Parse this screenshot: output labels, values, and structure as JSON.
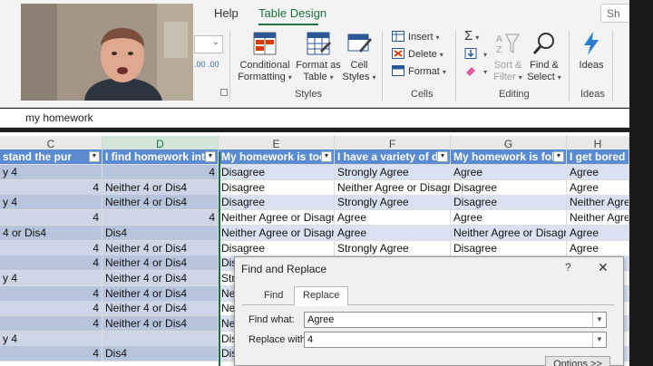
{
  "ribbon": {
    "tabs": {
      "help": "Help",
      "table_design": "Table Design"
    },
    "share": "Sh",
    "font_stub_arrow": "⌄",
    "number_stub": ".00  .00",
    "styles": {
      "conditional_formatting": [
        "Conditional",
        "Formatting"
      ],
      "format_as_table": [
        "Format as",
        "Table"
      ],
      "cell_styles": [
        "Cell",
        "Styles"
      ],
      "group_label": "Styles"
    },
    "cells": {
      "insert": "Insert",
      "delete": "Delete",
      "format": "Format",
      "group_label": "Cells"
    },
    "editing": {
      "sort_filter": [
        "Sort &",
        "Filter"
      ],
      "find_select": [
        "Find &",
        "Select"
      ],
      "group_label": "Editing"
    },
    "ideas": {
      "label": "Ideas",
      "group_label": "Ideas"
    },
    "colors": {
      "green": "#1e7145",
      "blue": "#2b5797",
      "red": "#d83b01"
    }
  },
  "formula_bar": {
    "text": "my homework"
  },
  "grid": {
    "column_headers": [
      "C",
      "D",
      "E",
      "F",
      "G",
      "H"
    ],
    "header_row": [
      "stand the pur",
      "I find homework inte",
      "My homework is too",
      "I have a variety of dif",
      "My homework is follo",
      "I get bored w"
    ],
    "rows": [
      [
        "y 4",
        "4",
        "Disagree",
        "Strongly Agree",
        "Agree",
        "Agree"
      ],
      [
        "4",
        "Neither 4 or Dis4",
        "Disagree",
        "Neither Agree or Disagree",
        "Disagree",
        "Agree"
      ],
      [
        "y 4",
        "Neither 4 or Dis4",
        "Disagree",
        "Strongly Agree",
        "Disagree",
        "Neither Agree"
      ],
      [
        "4",
        "4",
        "Neither Agree or Disagree",
        "Agree",
        "Agree",
        "Neither Agree"
      ],
      [
        "4 or Dis4",
        "Dis4",
        "Neither Agree or Disagree",
        "Agree",
        "Neither Agree or Disagree",
        "Agree"
      ],
      [
        "4",
        "Neither 4 or Dis4",
        "Disagree",
        "Strongly Agree",
        "Disagree",
        "Agree"
      ],
      [
        "4",
        "Neither 4 or Dis4",
        "Disagree",
        "",
        "",
        ""
      ],
      [
        "y 4",
        "Neither 4 or Dis4",
        "Str",
        "",
        "",
        ""
      ],
      [
        "4",
        "Neither 4 or Dis4",
        "Ne",
        "",
        "",
        ""
      ],
      [
        "4",
        "Neither 4 or Dis4",
        "Ne",
        "",
        "",
        ""
      ],
      [
        "4",
        "Neither 4 or Dis4",
        "Ne",
        "",
        "",
        ""
      ],
      [
        "y 4",
        "",
        "Dis",
        "",
        "",
        ""
      ],
      [
        "4",
        "Dis4",
        "Dis",
        "",
        "",
        ""
      ]
    ]
  },
  "dialog": {
    "title": "Find and Replace",
    "help": "?",
    "close": "✕",
    "tab_find": "Find",
    "tab_replace": "Replace",
    "find_label": "Find what:",
    "find_value": "Agree",
    "replace_label": "Replace with:",
    "replace_value": "4",
    "options_label": "Options >>"
  }
}
